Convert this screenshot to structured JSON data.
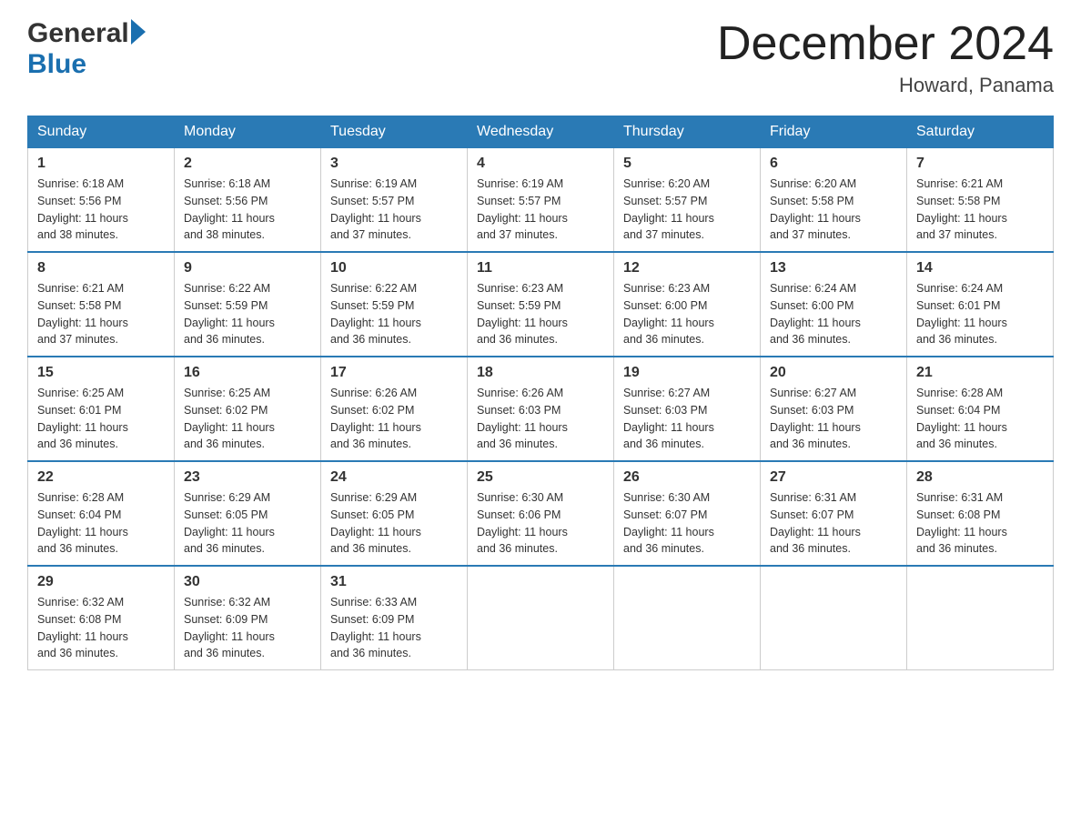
{
  "logo": {
    "general": "General",
    "blue": "Blue"
  },
  "title": "December 2024",
  "location": "Howard, Panama",
  "days_of_week": [
    "Sunday",
    "Monday",
    "Tuesday",
    "Wednesday",
    "Thursday",
    "Friday",
    "Saturday"
  ],
  "weeks": [
    [
      {
        "day": "1",
        "sunrise": "6:18 AM",
        "sunset": "5:56 PM",
        "daylight": "11 hours and 38 minutes."
      },
      {
        "day": "2",
        "sunrise": "6:18 AM",
        "sunset": "5:56 PM",
        "daylight": "11 hours and 38 minutes."
      },
      {
        "day": "3",
        "sunrise": "6:19 AM",
        "sunset": "5:57 PM",
        "daylight": "11 hours and 37 minutes."
      },
      {
        "day": "4",
        "sunrise": "6:19 AM",
        "sunset": "5:57 PM",
        "daylight": "11 hours and 37 minutes."
      },
      {
        "day": "5",
        "sunrise": "6:20 AM",
        "sunset": "5:57 PM",
        "daylight": "11 hours and 37 minutes."
      },
      {
        "day": "6",
        "sunrise": "6:20 AM",
        "sunset": "5:58 PM",
        "daylight": "11 hours and 37 minutes."
      },
      {
        "day": "7",
        "sunrise": "6:21 AM",
        "sunset": "5:58 PM",
        "daylight": "11 hours and 37 minutes."
      }
    ],
    [
      {
        "day": "8",
        "sunrise": "6:21 AM",
        "sunset": "5:58 PM",
        "daylight": "11 hours and 37 minutes."
      },
      {
        "day": "9",
        "sunrise": "6:22 AM",
        "sunset": "5:59 PM",
        "daylight": "11 hours and 36 minutes."
      },
      {
        "day": "10",
        "sunrise": "6:22 AM",
        "sunset": "5:59 PM",
        "daylight": "11 hours and 36 minutes."
      },
      {
        "day": "11",
        "sunrise": "6:23 AM",
        "sunset": "5:59 PM",
        "daylight": "11 hours and 36 minutes."
      },
      {
        "day": "12",
        "sunrise": "6:23 AM",
        "sunset": "6:00 PM",
        "daylight": "11 hours and 36 minutes."
      },
      {
        "day": "13",
        "sunrise": "6:24 AM",
        "sunset": "6:00 PM",
        "daylight": "11 hours and 36 minutes."
      },
      {
        "day": "14",
        "sunrise": "6:24 AM",
        "sunset": "6:01 PM",
        "daylight": "11 hours and 36 minutes."
      }
    ],
    [
      {
        "day": "15",
        "sunrise": "6:25 AM",
        "sunset": "6:01 PM",
        "daylight": "11 hours and 36 minutes."
      },
      {
        "day": "16",
        "sunrise": "6:25 AM",
        "sunset": "6:02 PM",
        "daylight": "11 hours and 36 minutes."
      },
      {
        "day": "17",
        "sunrise": "6:26 AM",
        "sunset": "6:02 PM",
        "daylight": "11 hours and 36 minutes."
      },
      {
        "day": "18",
        "sunrise": "6:26 AM",
        "sunset": "6:03 PM",
        "daylight": "11 hours and 36 minutes."
      },
      {
        "day": "19",
        "sunrise": "6:27 AM",
        "sunset": "6:03 PM",
        "daylight": "11 hours and 36 minutes."
      },
      {
        "day": "20",
        "sunrise": "6:27 AM",
        "sunset": "6:03 PM",
        "daylight": "11 hours and 36 minutes."
      },
      {
        "day": "21",
        "sunrise": "6:28 AM",
        "sunset": "6:04 PM",
        "daylight": "11 hours and 36 minutes."
      }
    ],
    [
      {
        "day": "22",
        "sunrise": "6:28 AM",
        "sunset": "6:04 PM",
        "daylight": "11 hours and 36 minutes."
      },
      {
        "day": "23",
        "sunrise": "6:29 AM",
        "sunset": "6:05 PM",
        "daylight": "11 hours and 36 minutes."
      },
      {
        "day": "24",
        "sunrise": "6:29 AM",
        "sunset": "6:05 PM",
        "daylight": "11 hours and 36 minutes."
      },
      {
        "day": "25",
        "sunrise": "6:30 AM",
        "sunset": "6:06 PM",
        "daylight": "11 hours and 36 minutes."
      },
      {
        "day": "26",
        "sunrise": "6:30 AM",
        "sunset": "6:07 PM",
        "daylight": "11 hours and 36 minutes."
      },
      {
        "day": "27",
        "sunrise": "6:31 AM",
        "sunset": "6:07 PM",
        "daylight": "11 hours and 36 minutes."
      },
      {
        "day": "28",
        "sunrise": "6:31 AM",
        "sunset": "6:08 PM",
        "daylight": "11 hours and 36 minutes."
      }
    ],
    [
      {
        "day": "29",
        "sunrise": "6:32 AM",
        "sunset": "6:08 PM",
        "daylight": "11 hours and 36 minutes."
      },
      {
        "day": "30",
        "sunrise": "6:32 AM",
        "sunset": "6:09 PM",
        "daylight": "11 hours and 36 minutes."
      },
      {
        "day": "31",
        "sunrise": "6:33 AM",
        "sunset": "6:09 PM",
        "daylight": "11 hours and 36 minutes."
      },
      null,
      null,
      null,
      null
    ]
  ],
  "labels": {
    "sunrise": "Sunrise:",
    "sunset": "Sunset:",
    "daylight": "Daylight:"
  }
}
